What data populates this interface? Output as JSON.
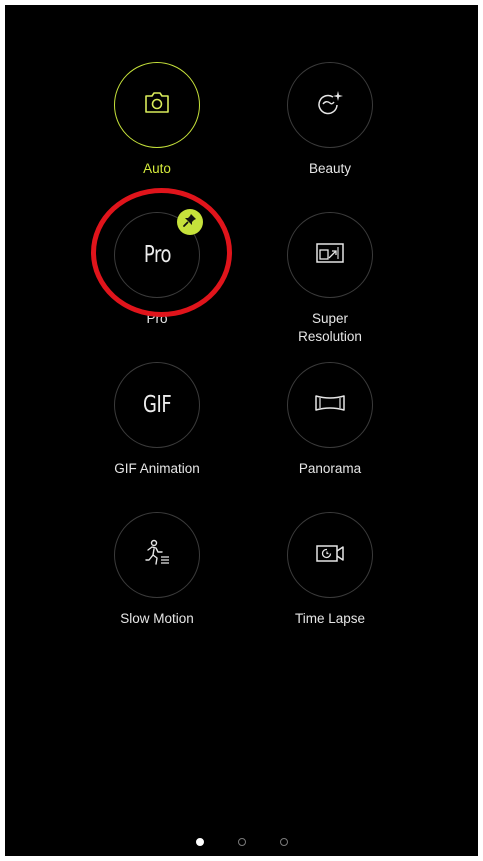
{
  "modes": [
    {
      "label": "Auto",
      "icon": "camera-icon",
      "active": true
    },
    {
      "label": "Beauty",
      "icon": "beauty-face-sparkle-icon"
    },
    {
      "label": "Pro",
      "icon_text": "Pro",
      "pinned": true,
      "pin_icon": "pin-icon"
    },
    {
      "label_line1": "Super",
      "label_line2": "Resolution",
      "icon": "super-resolution-icon"
    },
    {
      "label": "GIF Animation",
      "icon_text": "GIF"
    },
    {
      "label": "Panorama",
      "icon": "panorama-icon"
    },
    {
      "label": "Slow Motion",
      "icon": "slow-motion-runner-icon"
    },
    {
      "label": "Time Lapse",
      "icon": "time-lapse-camera-icon"
    }
  ],
  "pager": {
    "pages": 3,
    "current": 1
  },
  "colors": {
    "accent": "#c6e23b",
    "background": "#000000",
    "highlight_ring": "#e0141b",
    "circle_border": "#3b3b3b"
  }
}
